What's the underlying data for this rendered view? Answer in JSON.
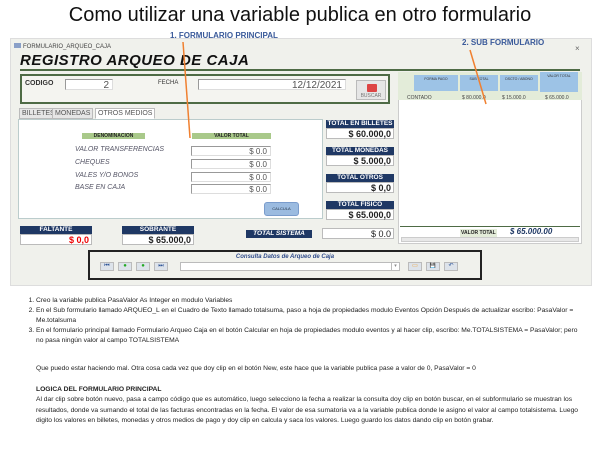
{
  "title": "Como utilizar una variable publica en otro formulario",
  "annotations": {
    "main": "1.  FORMULARIO PRINCIPAL",
    "sub": "2. SUB FORMULARIO"
  },
  "window": {
    "title": "FORMULARIO_ARQUEO_CAJA",
    "close": "×",
    "header": "REGISTRO ARQUEO DE CAJA"
  },
  "codigo": {
    "label": "CODIGO",
    "value": "2"
  },
  "fecha": {
    "label": "FECHA",
    "value": "12/12/2021"
  },
  "buscar": "BUSCAR",
  "tabs": [
    "BILLETES",
    "MONEDAS",
    "OTROS MEDIOS"
  ],
  "grid": {
    "col1": "DENOMINACION",
    "col2": "VALOR TOTAL",
    "rows": [
      {
        "label": "VALOR TRANSFERENCIAS",
        "value": "$ 0.0"
      },
      {
        "label": "CHEQUES",
        "value": "$ 0.0"
      },
      {
        "label": "VALES Y/O BONOS",
        "value": "$ 0.0"
      },
      {
        "label": "BASE EN CAJA",
        "value": "$ 0.0"
      }
    ]
  },
  "calcula": "CALCULA",
  "totals": [
    {
      "label": "TOTAL EN BILLETES",
      "value": "$ 60.000,0"
    },
    {
      "label": "TOTAL MONEDAS",
      "value": "$ 5.000,0"
    },
    {
      "label": "TOTAL OTROS",
      "value": "$ 0,0"
    },
    {
      "label": "TOTAL FISICO",
      "value": "$ 65.000,0"
    }
  ],
  "faltante": {
    "label": "FALTANTE",
    "value": "$ 0,0"
  },
  "sobrante": {
    "label": "SOBRANTE",
    "value": "$ 65.000,0"
  },
  "total_sistema": {
    "label": "TOTAL SISTEMA",
    "value": "$ 0.0"
  },
  "subform": {
    "headers": [
      "FORMA PAGO",
      "SUB TOTAL",
      "DSCTO / ABONO",
      "VALOR TOTAL"
    ],
    "row": [
      "CONTADO",
      "$ 80.000.0",
      "$ 15.000.0",
      "$ 65.000.0"
    ],
    "footer_label": "VALOR TOTAL",
    "footer_value": "$ 65.000.00"
  },
  "nav": {
    "title": "Consulta Datos de Arqueo de Caja",
    "buttons": [
      "⏮",
      "●",
      "●",
      "⏭"
    ],
    "actions": [
      "▭",
      "💾",
      "↶"
    ]
  },
  "instructions": [
    "Creo  la variable publica    PasaValor As Integer  en modulo  Variables",
    "En el Sub formulario llamado ARQUEO_L  en el Cuadro de Texto llamado totalsuma,  paso a hoja de propiedades   modulo Eventos  Opción Después de actualizar  escribo:  PasaValor = Me.totalsuma",
    "En el formulario principal llamado Formulario Arqueo Caja   en el botón Calcular en hoja de propiedades modulo eventos y al hacer clip, escribo: Me.TOTALSISTEMA = PasaValor; pero no  pasa ningún valor al campo TOTALSISTEMA"
  ],
  "question": "Que puedo estar haciendo mal.   Otra cosa cada vez que doy clip en el botón New, este hace que la variable publica pase a valor de 0,   PasaValor = 0",
  "logic_title": "LOGICA DEL FORMULARIO PRINCIPAL",
  "logic_text": "Al dar clip sobre botón nuevo, pasa a campo código que es automático, luego selecciono la fecha a realizar la consulta doy clip en botón buscar, en el subformulario se muestran los resultados, donde va sumando el total de las facturas encontradas en la fecha. El valor de esa sumatoria va a la variable publica donde le asigno el valor al campo totalsistema. Luego digito los valores en billetes, monedas y otros medios de pago y doy clip en calcula y saca los valores. Luego guardo los datos dando clip en botón grabar."
}
